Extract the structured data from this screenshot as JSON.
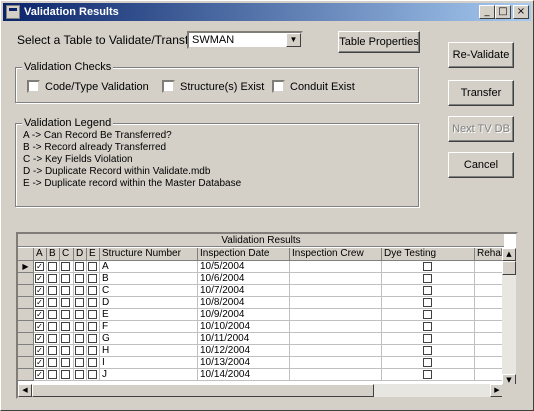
{
  "window": {
    "title": "Validation Results",
    "controls": {
      "minimize": "_",
      "maximize": "□",
      "close": "×"
    }
  },
  "table_select": {
    "label": "Select a Table to Validate/Transfer:",
    "value": "SWMAN"
  },
  "buttons": {
    "table_properties": "Table Properties",
    "revalidate": "Re-Validate",
    "transfer": "Transfer",
    "next_tv_db": "Next TV DB",
    "cancel": "Cancel"
  },
  "checks": {
    "title": "Validation Checks",
    "code_type": "Code/Type Validation",
    "structures": "Structure(s) Exist",
    "conduit": "Conduit Exist"
  },
  "legend": {
    "title": "Validation Legend",
    "lines": [
      "A -> Can Record Be Transferred?",
      "B -> Record already Transferred",
      "C -> Key Fields Violation",
      "D -> Duplicate Record within Validate.mdb",
      "E -> Duplicate record within the Master Database"
    ]
  },
  "grid": {
    "caption": "Validation Results",
    "columns": [
      "A",
      "B",
      "C",
      "D",
      "E",
      "Structure Number",
      "Inspection Date",
      "Inspection Crew",
      "Dye Testing",
      "Rehab I"
    ],
    "rows": [
      {
        "structure": "A",
        "date": "10/5/2004"
      },
      {
        "structure": "B",
        "date": "10/6/2004"
      },
      {
        "structure": "C",
        "date": "10/7/2004"
      },
      {
        "structure": "D",
        "date": "10/8/2004"
      },
      {
        "structure": "E",
        "date": "10/9/2004"
      },
      {
        "structure": "F",
        "date": "10/10/2004"
      },
      {
        "structure": "G",
        "date": "10/11/2004"
      },
      {
        "structure": "H",
        "date": "10/12/2004"
      },
      {
        "structure": "I",
        "date": "10/13/2004"
      },
      {
        "structure": "J",
        "date": "10/14/2004"
      }
    ],
    "current_row_marker": "▶",
    "checkmark": "✓"
  }
}
